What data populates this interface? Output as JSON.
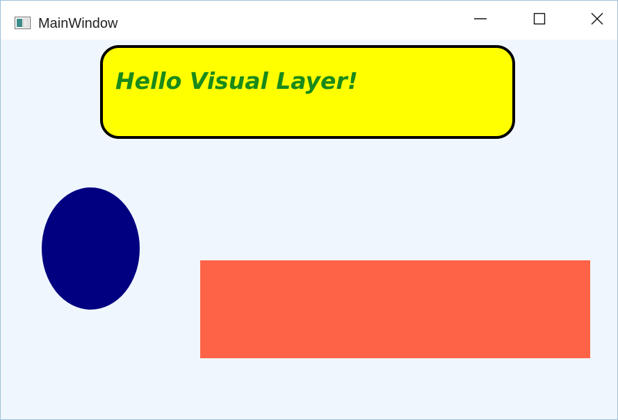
{
  "window": {
    "title": "MainWindow",
    "app_icon": "window-app-icon",
    "controls": {
      "minimize_icon": "minimize-icon",
      "maximize_icon": "maximize-icon",
      "close_icon": "close-icon"
    }
  },
  "canvas": {
    "background_color": "#f0f6fd",
    "text_box": {
      "text": "Hello Visual Layer!",
      "fill_color": "#ffff00",
      "border_color": "#000000",
      "text_color": "#1a8a1a"
    },
    "ellipse": {
      "fill_color": "#000080"
    },
    "rectangle": {
      "fill_color": "#ff6347"
    }
  }
}
